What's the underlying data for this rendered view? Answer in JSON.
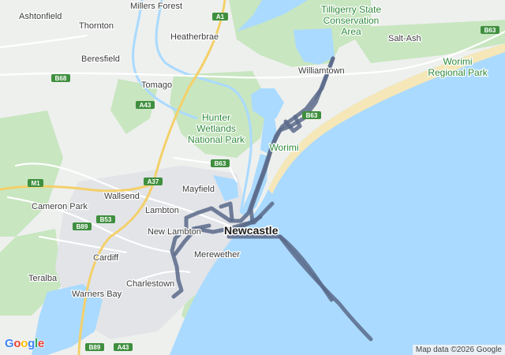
{
  "map": {
    "places": [
      {
        "id": "ashtonfield",
        "name": "Ashtonfield"
      },
      {
        "id": "millers-forest",
        "name": "Millers Forest"
      },
      {
        "id": "thornton",
        "name": "Thornton"
      },
      {
        "id": "heatherbrae",
        "name": "Heatherbrae"
      },
      {
        "id": "beresfield",
        "name": "Beresfield"
      },
      {
        "id": "tomago",
        "name": "Tomago"
      },
      {
        "id": "williamtown",
        "name": "Williamtown"
      },
      {
        "id": "salt-ash",
        "name": "Salt-Ash"
      },
      {
        "id": "mayfield",
        "name": "Mayfield"
      },
      {
        "id": "wallsend",
        "name": "Wallsend"
      },
      {
        "id": "cameron-park",
        "name": "Cameron Park"
      },
      {
        "id": "lambton",
        "name": "Lambton"
      },
      {
        "id": "new-lambton",
        "name": "New Lambton"
      },
      {
        "id": "cardiff",
        "name": "Cardiff"
      },
      {
        "id": "merewether",
        "name": "Merewether"
      },
      {
        "id": "teralba",
        "name": "Teralba"
      },
      {
        "id": "charlestown",
        "name": "Charlestown"
      },
      {
        "id": "warners-bay",
        "name": "Warners Bay"
      }
    ],
    "city": "Newcastle",
    "parks": [
      {
        "id": "tilligerry",
        "lines": [
          "Tilligerry State",
          "Conservation",
          "Area"
        ]
      },
      {
        "id": "worimi-regional",
        "lines": [
          "Worimi",
          "Regional Park"
        ]
      },
      {
        "id": "hunter-wetlands",
        "lines": [
          "Hunter",
          "Wetlands",
          "National Park"
        ]
      },
      {
        "id": "worimi",
        "lines": [
          "Worimi"
        ]
      }
    ],
    "road_shields": [
      {
        "id": "a1",
        "label": "A1"
      },
      {
        "id": "b63-ne",
        "label": "B63"
      },
      {
        "id": "b68",
        "label": "B68"
      },
      {
        "id": "a43-n",
        "label": "A43"
      },
      {
        "id": "b63-mid",
        "label": "B63"
      },
      {
        "id": "b63-city",
        "label": "B63"
      },
      {
        "id": "m1",
        "label": "M1"
      },
      {
        "id": "a37",
        "label": "A37"
      },
      {
        "id": "b53",
        "label": "B53"
      },
      {
        "id": "b89-w",
        "label": "B89"
      },
      {
        "id": "b89-s",
        "label": "B89"
      },
      {
        "id": "a43-s",
        "label": "A43"
      }
    ],
    "colors": {
      "sea": "#aadaff",
      "land": "#eef0ee",
      "park": "#c8e6c0",
      "urban": "#e2e4e8",
      "road": "#ffffff",
      "highway": "#f4d06a",
      "route": "#5a6a8a",
      "shield": "#3f8f3f",
      "sand": "#f6e7b8"
    }
  },
  "attribution": "Map data ©2026 Google",
  "logo": {
    "letters": [
      "G",
      "o",
      "o",
      "g",
      "l",
      "e"
    ],
    "colors": [
      "#4285f4",
      "#ea4335",
      "#fbbc05",
      "#4285f4",
      "#34a853",
      "#ea4335"
    ]
  }
}
